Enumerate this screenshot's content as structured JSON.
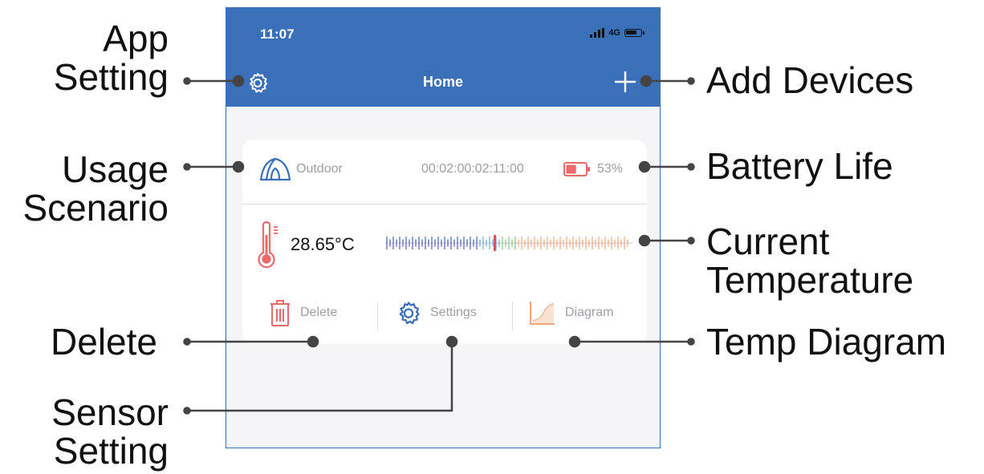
{
  "status_bar": {
    "time": "11:07",
    "network": "4G"
  },
  "nav": {
    "title": "Home",
    "settings_icon": "gear-icon",
    "add_icon": "plus-icon"
  },
  "device": {
    "scenario": "Outdoor",
    "scenario_icon": "tent-icon",
    "duration": "00:02:00:02:11:00",
    "battery": "53%",
    "battery_level": 0.53,
    "temperature": "28.65°C",
    "actions": {
      "delete": "Delete",
      "settings": "Settings",
      "diagram": "Diagram"
    }
  },
  "callouts": {
    "app_setting": "App\nSetting",
    "add_devices": "Add Devices",
    "usage_scenario": "Usage\nScenario",
    "battery_life": "Battery Life",
    "current_temperature": "Current\nTemperature",
    "delete": "Delete",
    "temp_diagram": "Temp Diagram",
    "sensor_setting": "Sensor\nSetting"
  },
  "colors": {
    "header": "#3a6fb9",
    "accent_red": "#e86a6a",
    "icon_blue": "#3a6fb9",
    "diagram_orange": "#f0a87c"
  }
}
